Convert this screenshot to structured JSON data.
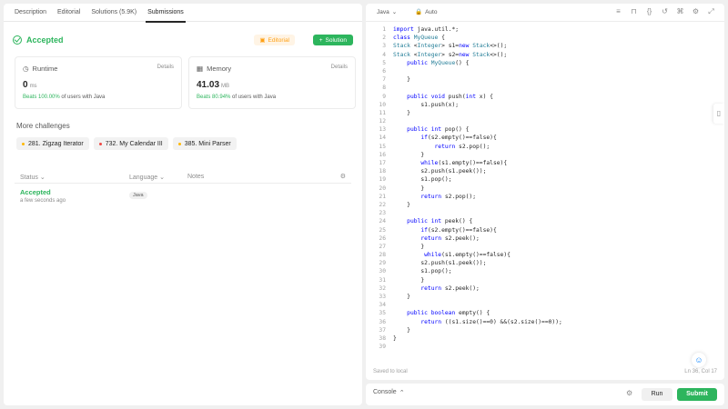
{
  "left_tabs": [
    "Description",
    "Editorial",
    "Solutions (5.9K)",
    "Submissions"
  ],
  "result": {
    "status": "Accepted",
    "editorial_label": "Editorial",
    "solution_label": "Solution"
  },
  "runtime": {
    "label": "Runtime",
    "details": "Details",
    "value": "0",
    "unit": "ms",
    "beats_pct": "Beats 100.00%",
    "beats_text": "of users with Java"
  },
  "memory": {
    "label": "Memory",
    "details": "Details",
    "value": "41.03",
    "unit": "MB",
    "beats_pct": "Beats 80.94%",
    "beats_text": "of users with Java"
  },
  "more_challenges": {
    "title": "More challenges",
    "items": [
      {
        "label": "281. Zigzag Iterator",
        "difficulty": "medium"
      },
      {
        "label": "732. My Calendar III",
        "difficulty": "hard"
      },
      {
        "label": "385. Mini Parser",
        "difficulty": "medium"
      }
    ]
  },
  "table": {
    "headers": {
      "status": "Status",
      "language": "Language",
      "notes": "Notes"
    },
    "rows": [
      {
        "status": "Accepted",
        "time": "a few seconds ago",
        "language": "Java"
      }
    ]
  },
  "editor": {
    "language": "Java",
    "mode": "Auto",
    "saved_text": "Saved to local",
    "cursor": "Ln 36, Col 17",
    "lines": [
      "import java.util.*;",
      "class MyQueue {",
      "Stack <Integer> s1=new Stack<>();",
      "Stack <Integer> s2=new Stack<>();",
      "    public MyQueue() {",
      "",
      "    }",
      "",
      "    public void push(int x) {",
      "        s1.push(x);",
      "    }",
      "",
      "    public int pop() {",
      "        if(s2.empty()==false){",
      "            return s2.pop();",
      "        }",
      "        while(s1.empty()==false){",
      "        s2.push(s1.peek());",
      "        s1.pop();",
      "        }",
      "        return s2.pop();",
      "    }",
      "",
      "    public int peek() {",
      "        if(s2.empty()==false){",
      "        return s2.peek();",
      "        }",
      "         while(s1.empty()==false){",
      "        s2.push(s1.peek());",
      "        s1.pop();",
      "        }",
      "        return s2.peek();",
      "    }",
      "",
      "    public boolean empty() {",
      "        return ((s1.size()==0) &&(s2.size()==0));",
      "    }",
      "}",
      ""
    ]
  },
  "console": {
    "label": "Console",
    "run_label": "Run",
    "submit_label": "Submit"
  },
  "colors": {
    "accent_green": "#2db55d",
    "accent_orange": "#ffa116",
    "keyword_blue": "#0000ff"
  }
}
